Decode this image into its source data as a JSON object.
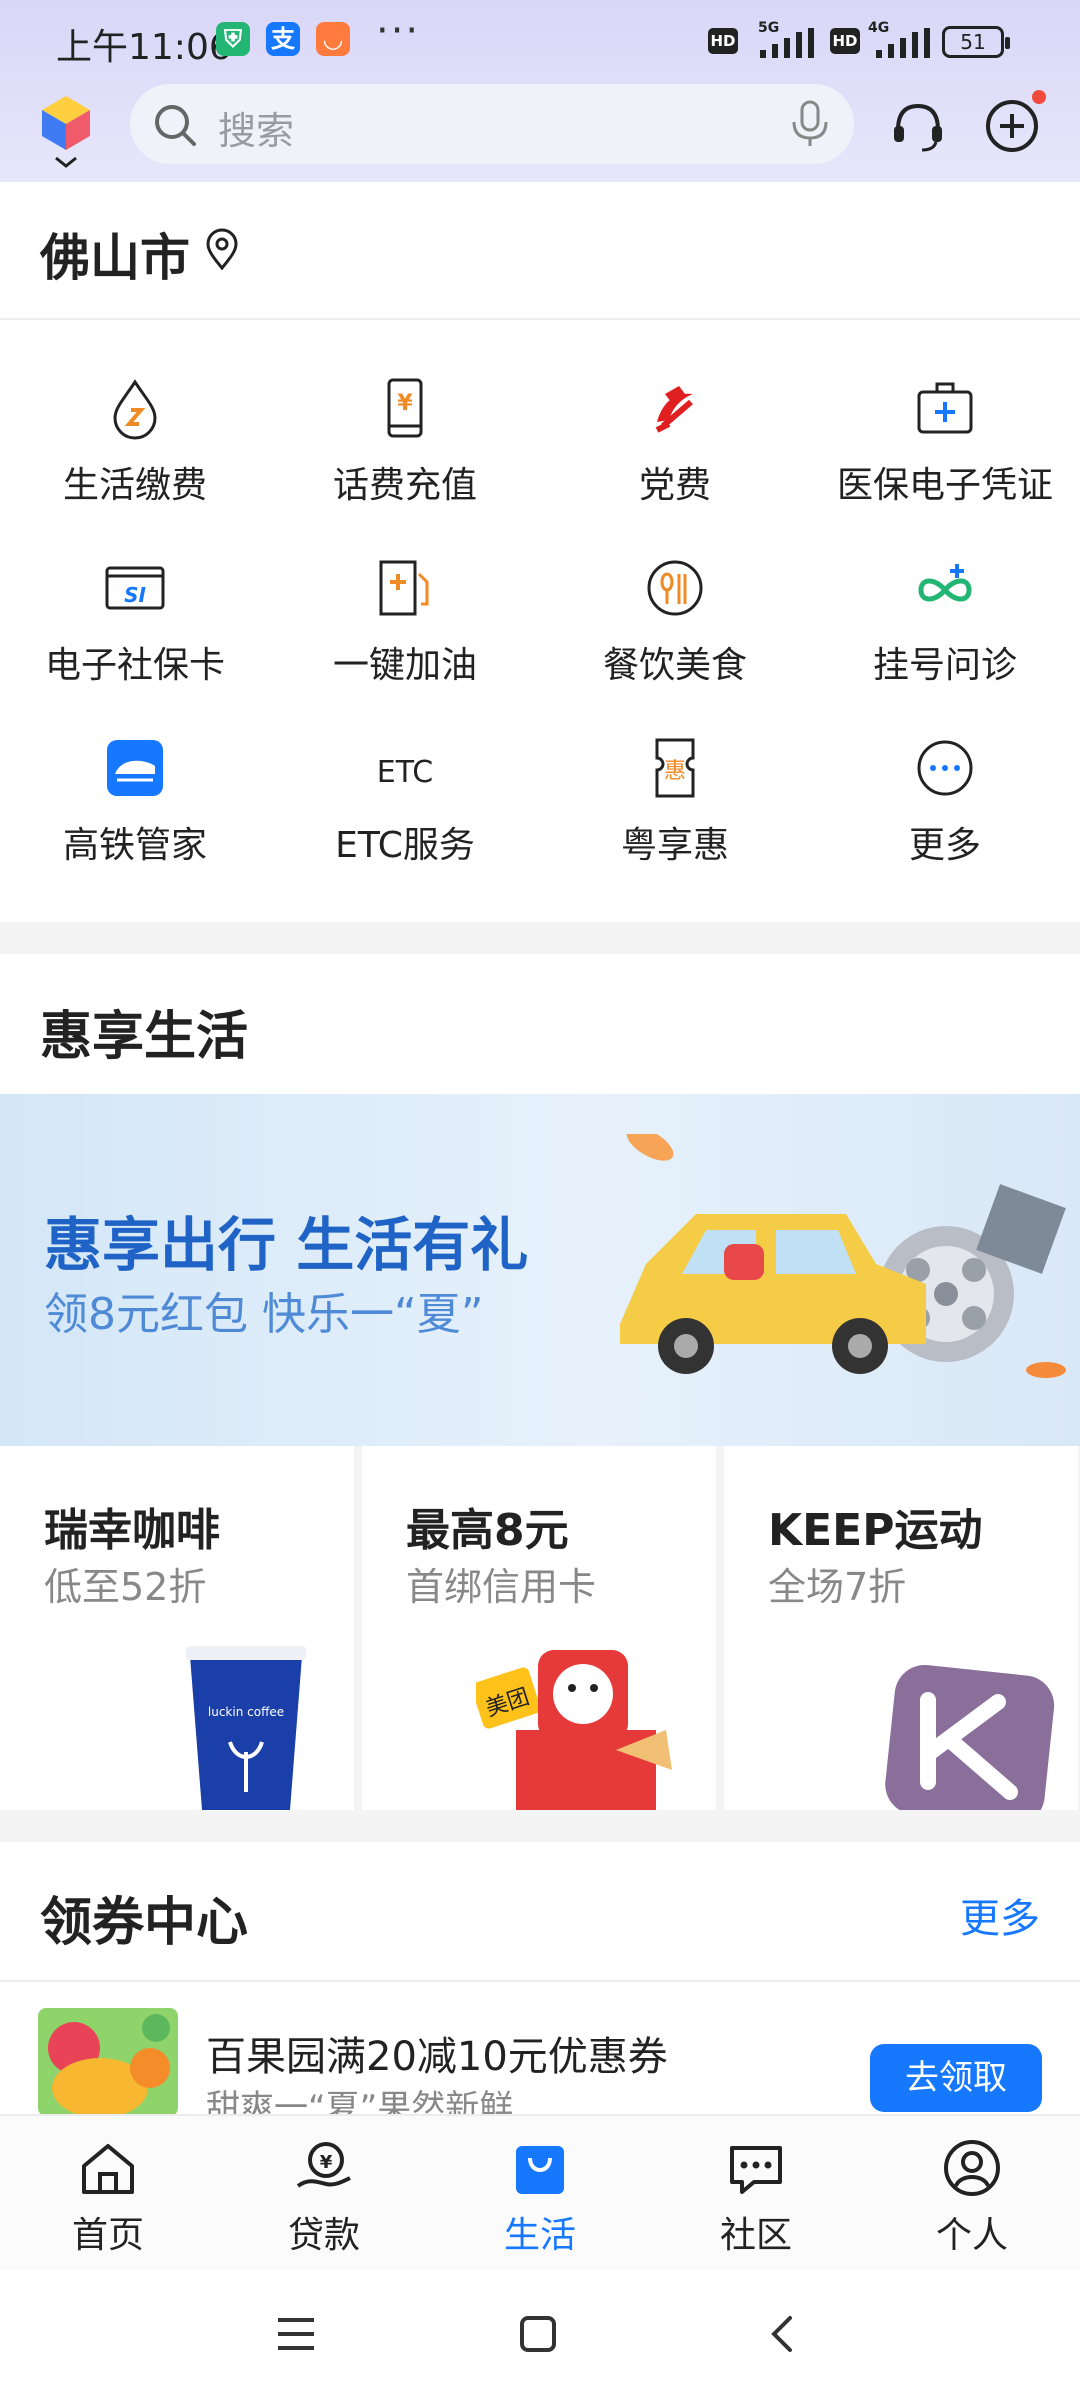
{
  "status_bar": {
    "time": "上午11:06",
    "more": "···",
    "signal1": "5G",
    "signal2": "4G",
    "hd": "HD",
    "battery": "51"
  },
  "header": {
    "search_placeholder": "搜索"
  },
  "location": {
    "city": "佛山市"
  },
  "services": [
    {
      "label": "生活缴费",
      "icon": "water-drop-icon"
    },
    {
      "label": "话费充值",
      "icon": "phone-yuan-icon"
    },
    {
      "label": "党费",
      "icon": "party-emblem-icon"
    },
    {
      "label": "医保电子凭证",
      "icon": "medical-bag-icon"
    },
    {
      "label": "电子社保卡",
      "icon": "si-card-icon"
    },
    {
      "label": "一键加油",
      "icon": "fuel-icon"
    },
    {
      "label": "餐饮美食",
      "icon": "dining-icon"
    },
    {
      "label": "挂号问诊",
      "icon": "medical-cross-icon"
    },
    {
      "label": "高铁管家",
      "icon": "train-icon"
    },
    {
      "label": "ETC服务",
      "icon": "etc-icon"
    },
    {
      "label": "粤享惠",
      "icon": "coupon-icon"
    },
    {
      "label": "更多",
      "icon": "more-dots-icon"
    }
  ],
  "etc_icon_text": "ETC",
  "coupon_icon_text": "惠",
  "si_icon_text": "SI",
  "sections": {
    "life": "惠享生活",
    "coupons": "领券中心",
    "more": "更多"
  },
  "banner": {
    "title": "惠享出行 生活有礼",
    "subtitle": "领8元红包 快乐一“夏”"
  },
  "promo_cards": [
    {
      "title": "瑞幸咖啡",
      "subtitle": "低至52折",
      "brand": "luckin coffee"
    },
    {
      "title": "最高8元",
      "subtitle": "首绑信用卡",
      "brand": "美团"
    },
    {
      "title": "KEEP运动",
      "subtitle": "全场7折",
      "brand": "K"
    }
  ],
  "coupon": {
    "title": "百果园满20减10元优惠券",
    "subtitle": "甜爽一“夏”果然新鲜",
    "button": "去领取"
  },
  "bottom_nav": [
    {
      "label": "首页",
      "icon": "home-icon",
      "active": false
    },
    {
      "label": "贷款",
      "icon": "loan-icon",
      "active": false
    },
    {
      "label": "生活",
      "icon": "life-bag-icon",
      "active": true
    },
    {
      "label": "社区",
      "icon": "chat-icon",
      "active": false
    },
    {
      "label": "个人",
      "icon": "person-icon",
      "active": false
    }
  ],
  "colors": {
    "accent": "#1677ff",
    "banner_title": "#1f63c7",
    "orange": "#f08a24",
    "red": "#e02020"
  }
}
